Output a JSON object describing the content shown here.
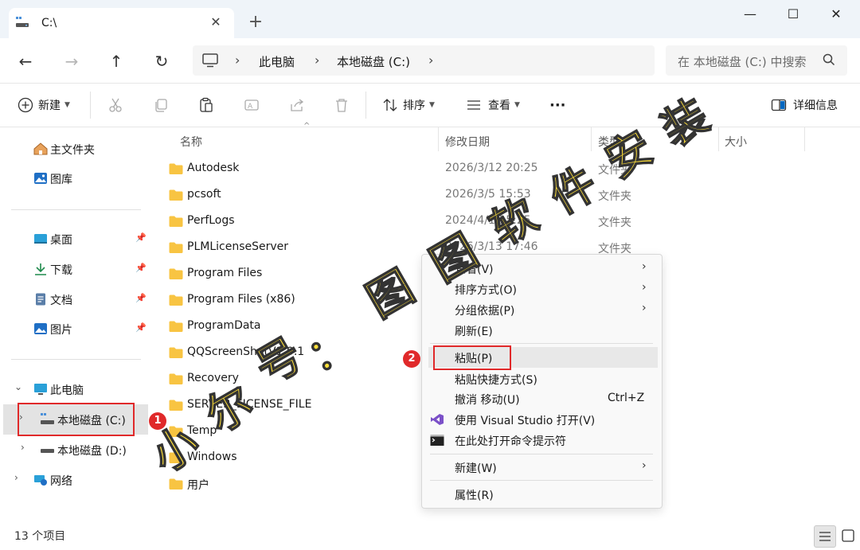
{
  "window": {
    "tab_title": "C:\\",
    "close_tab": "✕",
    "new_tab": "+",
    "min": "—",
    "max": "☐",
    "close": "✕"
  },
  "addressbar": {
    "back": "←",
    "forward": "→",
    "up": "↑",
    "refresh": "↻",
    "breadcrumbs": [
      "此电脑",
      "本地磁盘 (C:)"
    ],
    "search_placeholder": "在 本地磁盘 (C:) 中搜索"
  },
  "toolbar": {
    "new_label": "新建",
    "sort_label": "排序",
    "view_label": "查看",
    "more": "···",
    "details_label": "详细信息"
  },
  "sidebar": {
    "home": "主文件夹",
    "gallery": "图库",
    "desktop": "桌面",
    "downloads": "下载",
    "documents": "文档",
    "pictures": "图片",
    "this_pc": "此电脑",
    "drive_c": "本地磁盘 (C:)",
    "drive_d": "本地磁盘 (D:)",
    "network": "网络"
  },
  "columns": {
    "name": "名称",
    "date": "修改日期",
    "type": "类型",
    "size": "大小"
  },
  "files": [
    {
      "name": "Autodesk",
      "date": "2026/3/12 20:25",
      "type": "文件夹"
    },
    {
      "name": "pcsoft",
      "date": "2026/3/5 15:53",
      "type": "文件夹"
    },
    {
      "name": "PerfLogs",
      "date": "2024/4/1 15:25",
      "type": "文件夹"
    },
    {
      "name": "PLMLicenseServer",
      "date": "2026/3/13 17:46",
      "type": "文件夹"
    },
    {
      "name": "Program Files",
      "date": "",
      "type": ""
    },
    {
      "name": "Program Files (x86)",
      "date": "",
      "type": ""
    },
    {
      "name": "ProgramData",
      "date": "",
      "type": ""
    },
    {
      "name": "QQScreenShotV1.0.1",
      "date": "",
      "type": ""
    },
    {
      "name": "Recovery",
      "date": "",
      "type": ""
    },
    {
      "name": "SERVER_LICENSE_FILE",
      "date": "",
      "type": ""
    },
    {
      "name": "Temp",
      "date": "",
      "type": ""
    },
    {
      "name": "Windows",
      "date": "",
      "type": ""
    },
    {
      "name": "用户",
      "date": "",
      "type": ""
    }
  ],
  "context_menu": {
    "view": "查看(V)",
    "sort_by": "排序方式(O)",
    "group_by": "分组依据(P)",
    "refresh": "刷新(E)",
    "paste": "粘贴(P)",
    "paste_shortcut": "粘贴快捷方式(S)",
    "undo_move": "撤消 移动(U)",
    "undo_shortcut": "Ctrl+Z",
    "open_vs": "使用 Visual Studio 打开(V)",
    "open_cmd": "在此处打开命令提示符",
    "new": "新建(W)",
    "properties": "属性(R)"
  },
  "badges": {
    "one": "1",
    "two": "2"
  },
  "status": {
    "count": "13 个项目"
  },
  "watermark": {
    "a": "小",
    "b": "尔",
    "c": "号",
    "d": "：",
    "e": "图",
    "f": "图",
    "g": "软",
    "h": "件",
    "i": "安",
    "j": "装"
  },
  "colors": {
    "accent": "#0067c0",
    "folder": "#f8c442",
    "highlight": "#e0292a"
  }
}
